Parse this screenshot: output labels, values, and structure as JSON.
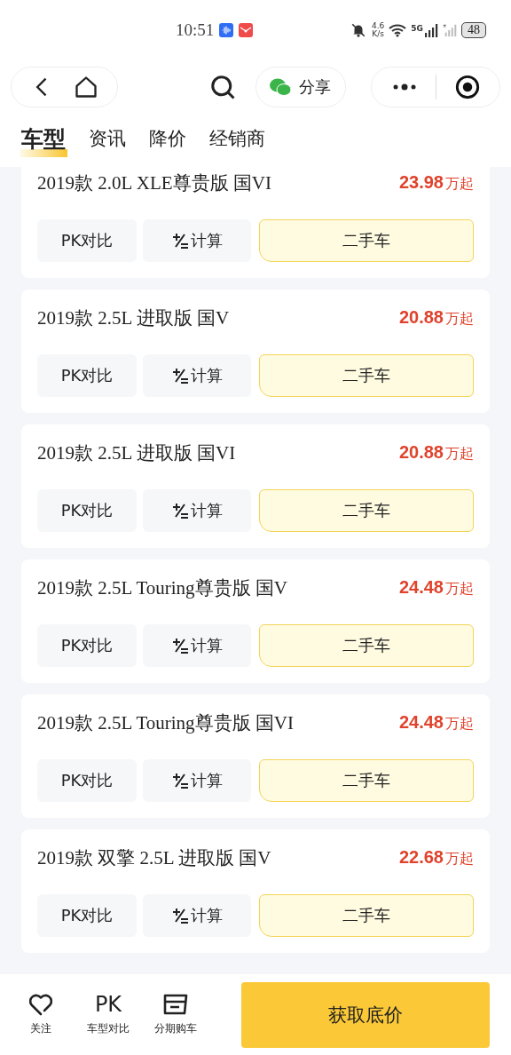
{
  "status_bar": {
    "time": "10:51",
    "speed_value": "4.6",
    "speed_unit": "K/s",
    "network": "5G",
    "battery": "48"
  },
  "nav": {
    "share": "分享"
  },
  "tabs": [
    {
      "label": "车型",
      "selected": true
    },
    {
      "label": "资讯",
      "selected": false
    },
    {
      "label": "降价",
      "selected": false
    },
    {
      "label": "经销商",
      "selected": false
    }
  ],
  "cars": [
    {
      "title": "2019款 2.0L XLE尊贵版 国VI",
      "price": "23.98",
      "unit": "万起",
      "compare": "PK对比",
      "calc": "计算",
      "used": "二手车"
    },
    {
      "title": "2019款 2.5L 进取版 国V",
      "price": "20.88",
      "unit": "万起",
      "compare": "PK对比",
      "calc": "计算",
      "used": "二手车"
    },
    {
      "title": "2019款 2.5L 进取版 国VI",
      "price": "20.88",
      "unit": "万起",
      "compare": "PK对比",
      "calc": "计算",
      "used": "二手车"
    },
    {
      "title": "2019款 2.5L Touring尊贵版 国V",
      "price": "24.48",
      "unit": "万起",
      "compare": "PK对比",
      "calc": "计算",
      "used": "二手车"
    },
    {
      "title": "2019款 2.5L Touring尊贵版 国VI",
      "price": "24.48",
      "unit": "万起",
      "compare": "PK对比",
      "calc": "计算",
      "used": "二手车"
    },
    {
      "title": "2019款 双擎 2.5L 进取版 国V",
      "price": "22.68",
      "unit": "万起",
      "compare": "PK对比",
      "calc": "计算",
      "used": "二手车"
    }
  ],
  "bottom_bar": {
    "items": [
      {
        "kind": "heart",
        "label": "关注"
      },
      {
        "kind": "pk",
        "icon_text": "PK",
        "label": "车型对比"
      },
      {
        "kind": "card",
        "label": "分期购车"
      }
    ],
    "cta": "获取底价"
  }
}
